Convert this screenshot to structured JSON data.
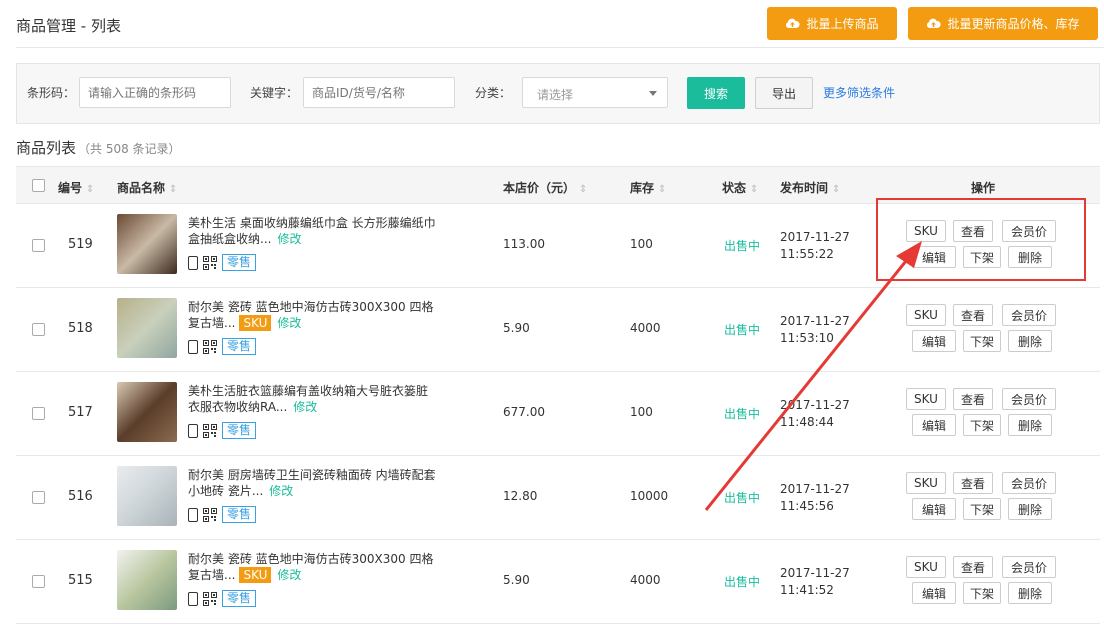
{
  "header": {
    "title": "商品管理 - 列表",
    "upload_button": "批量上传商品",
    "update_button": "批量更新商品价格、库存"
  },
  "filter": {
    "barcode_label": "条形码：",
    "barcode_placeholder": "请输入正确的条形码",
    "keyword_label": "关键字：",
    "keyword_placeholder": "商品ID/货号/名称",
    "category_label": "分类：",
    "category_value": "请选择",
    "search_button": "搜索",
    "export_button": "导出",
    "more_filters": "更多筛选条件"
  },
  "list": {
    "title": "商品列表",
    "count": "（共 508 条记录）"
  },
  "table": {
    "headers": {
      "id": "编号",
      "name": "商品名称",
      "price": "本店价（元）",
      "stock": "库存",
      "status": "状态",
      "time": "发布时间",
      "ops": "操作"
    },
    "rows": [
      {
        "id": "519",
        "name": "美朴生活 桌面收纳藤编纸巾盒 长方形藤编纸巾盒抽纸盒收纳...",
        "has_sku": false,
        "price": "113.00",
        "stock": "100",
        "status": "出售中",
        "date": "2017-11-27",
        "time": "11:55:22"
      },
      {
        "id": "518",
        "name": "耐尔美 瓷砖 蓝色地中海仿古砖300X300 四格复古墙...",
        "has_sku": true,
        "price": "5.90",
        "stock": "4000",
        "status": "出售中",
        "date": "2017-11-27",
        "time": "11:53:10"
      },
      {
        "id": "517",
        "name": "美朴生活脏衣篮藤编有盖收纳箱大号脏衣篓脏衣服衣物收纳RA...",
        "has_sku": false,
        "price": "677.00",
        "stock": "100",
        "status": "出售中",
        "date": "2017-11-27",
        "time": "11:48:44"
      },
      {
        "id": "516",
        "name": "耐尔美 厨房墙砖卫生间瓷砖釉面砖 内墙砖配套小地砖 瓷片...",
        "has_sku": false,
        "price": "12.80",
        "stock": "10000",
        "status": "出售中",
        "date": "2017-11-27",
        "time": "11:45:56"
      },
      {
        "id": "515",
        "name": "耐尔美 瓷砖 蓝色地中海仿古砖300X300 四格复古墙...",
        "has_sku": true,
        "price": "5.90",
        "stock": "4000",
        "status": "出售中",
        "date": "2017-11-27",
        "time": "11:41:52"
      }
    ],
    "labels": {
      "edit": "修改",
      "sku": "SKU",
      "retail": "零售"
    },
    "actions": {
      "sku": "SKU",
      "view": "查看",
      "member_price": "会员价",
      "edit": "编辑",
      "unlist": "下架",
      "delete": "删除"
    }
  },
  "colors": {
    "accent_orange": "#f39c12",
    "accent_green": "#1abc9c",
    "link_blue": "#2a7ae2",
    "annotation_red": "#e53935"
  }
}
